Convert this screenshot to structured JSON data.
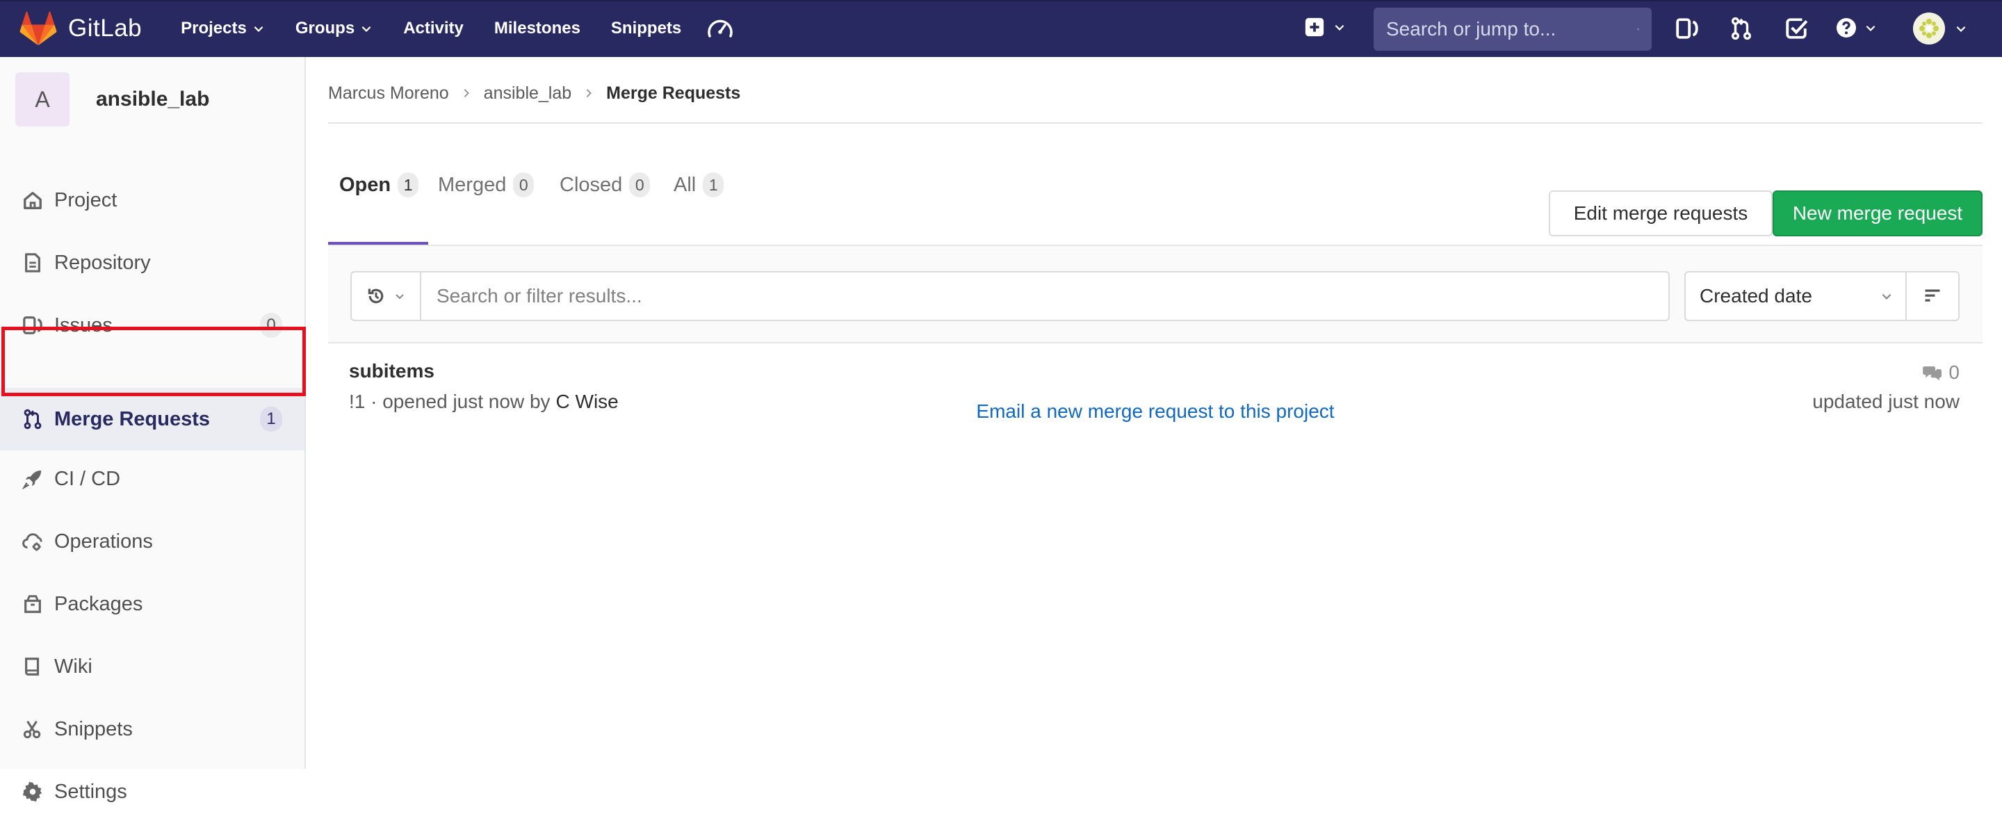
{
  "navbar": {
    "brand": "GitLab",
    "links": [
      {
        "label": "Projects",
        "dropdown": true
      },
      {
        "label": "Groups",
        "dropdown": true
      },
      {
        "label": "Activity",
        "dropdown": false
      },
      {
        "label": "Milestones",
        "dropdown": false
      },
      {
        "label": "Snippets",
        "dropdown": false
      }
    ],
    "search_placeholder": "Search or jump to...",
    "icons": [
      "gauge-icon",
      "plus-square-icon",
      "search-icon",
      "issues-icon",
      "merge-request-icon",
      "todo-check-icon",
      "help-icon",
      "avatar"
    ]
  },
  "sidebar": {
    "project_initial": "A",
    "project_name": "ansible_lab",
    "items": [
      {
        "label": "Project",
        "icon": "home-icon"
      },
      {
        "label": "Repository",
        "icon": "doc-icon"
      },
      {
        "label": "Issues",
        "icon": "issues-icon",
        "count": "0"
      },
      {
        "label": "Merge Requests",
        "icon": "merge-request-icon",
        "count": "1",
        "active": true
      },
      {
        "label": "CI / CD",
        "icon": "rocket-icon"
      },
      {
        "label": "Operations",
        "icon": "cloud-gear-icon"
      },
      {
        "label": "Packages",
        "icon": "package-icon"
      },
      {
        "label": "Wiki",
        "icon": "book-icon"
      },
      {
        "label": "Snippets",
        "icon": "scissors-icon"
      },
      {
        "label": "Settings",
        "icon": "gear-icon"
      }
    ]
  },
  "breadcrumb": {
    "items": [
      "Marcus Moreno",
      "ansible_lab",
      "Merge Requests"
    ]
  },
  "tabs": [
    {
      "label": "Open",
      "count": "1",
      "active": true
    },
    {
      "label": "Merged",
      "count": "0"
    },
    {
      "label": "Closed",
      "count": "0"
    },
    {
      "label": "All",
      "count": "1"
    }
  ],
  "actions": {
    "edit_label": "Edit merge requests",
    "new_label": "New merge request"
  },
  "filter": {
    "placeholder": "Search or filter results...",
    "sort_value": "Created date"
  },
  "merge_requests": [
    {
      "title": "subitems",
      "meta": "!1 · opened just now by",
      "author": "C Wise",
      "comments": "0",
      "updated": "updated just now"
    }
  ],
  "email_link": "Email a new merge request to this project",
  "colors": {
    "navbar": "#292961",
    "accent_green": "#1aaa55",
    "tab_ink": "#6b4fbb",
    "link": "#1068bf",
    "highlight": "#e8101e"
  }
}
